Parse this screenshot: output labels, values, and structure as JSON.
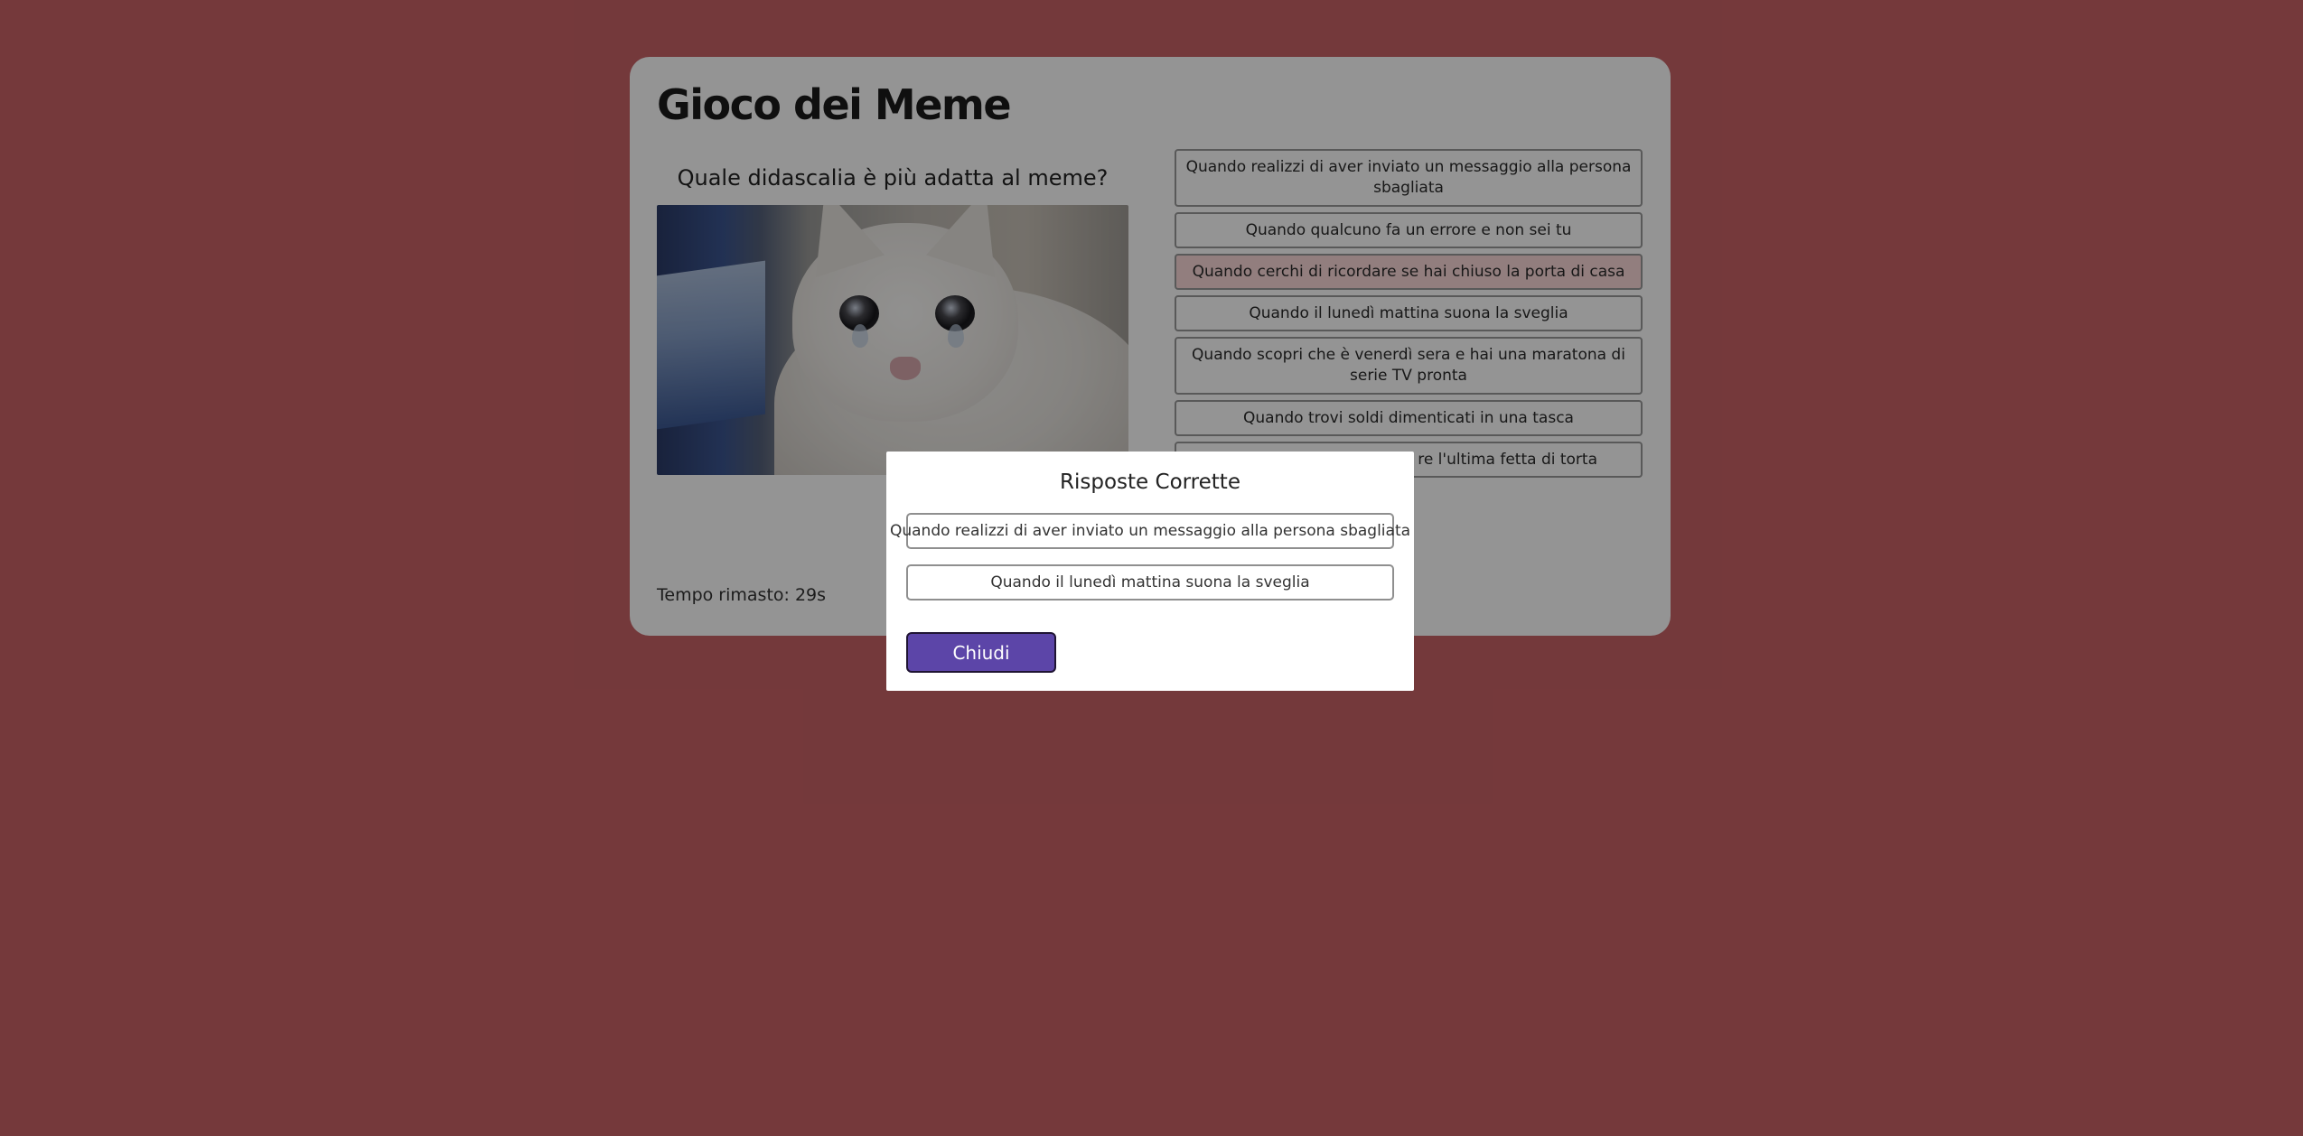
{
  "game": {
    "title": "Gioco dei Meme",
    "question": "Quale didascalia è più adatta al meme?",
    "meme_image": "crying-cat-meme",
    "answers": [
      {
        "text": "Quando realizzi di aver inviato un messaggio alla persona sbagliata",
        "selected": false
      },
      {
        "text": "Quando qualcuno fa un errore e non sei tu",
        "selected": false
      },
      {
        "text": "Quando cerchi di ricordare se hai chiuso la porta di casa",
        "selected": true
      },
      {
        "text": "Quando il lunedì mattina suona la sveglia",
        "selected": false
      },
      {
        "text": "Quando scopri che è venerdì sera e hai una maratona di serie TV pronta",
        "selected": false
      },
      {
        "text": "Quando trovi soldi dimenticati in una tasca",
        "selected": false
      },
      {
        "text": "re l'ultima fetta di torta",
        "selected": false
      }
    ],
    "timer_text": "Tempo rimasto: 29s"
  },
  "modal": {
    "title": "Risposte Corrette",
    "correct_answers": [
      "Quando realizzi di aver inviato un messaggio alla persona sbagliata",
      "Quando il lunedì mattina suona la sveglia"
    ],
    "close_label": "Chiudi"
  },
  "colors": {
    "background": "#c96266",
    "overlay_tint": "rgba(0,0,0,0.42)",
    "card": "#ffffff",
    "selected_answer": "#fbdada",
    "close_button": "#5c45a8"
  }
}
